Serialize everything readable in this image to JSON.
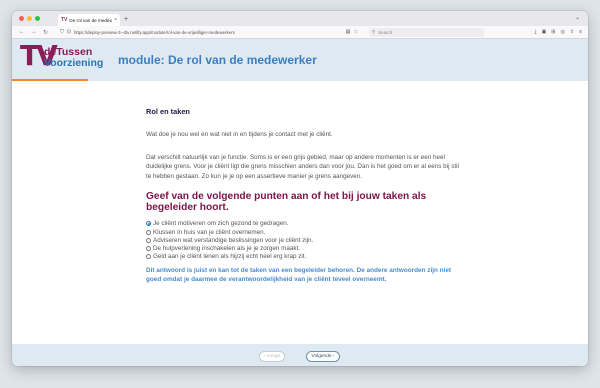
{
  "browser": {
    "tab_title": "De rol van de medewerker",
    "tab_favicon": "TV",
    "url": "https://deploy-preview-3--dtv.netlify.app/module/rol-van-de-vrijwilliger-medewerkers",
    "search_placeholder": "Search"
  },
  "header": {
    "logo_mark": "TV",
    "logo_line1": "deTussen",
    "logo_line2": "Voorziening",
    "module_title": "module: De rol van de medewerker"
  },
  "content": {
    "section_title": "Rol en taken",
    "intro": "Wat doe je nou wel en wat niet in en tijdens je contact met je cliënt.",
    "paragraph": "Dat verschilt natuurlijk van je functie. Soms is er een grijs gebied, maar op andere momenten is er een heel duidelijke grens. Voor je cliënt ligt die grens misschien anders dan voor jou. Dan is het goed om er al eens bij stil te hebben gestaan. Zo kun je je op een assertieve manier je grens aangeven.",
    "question": "Geef van de volgende punten aan of het bij jouw taken als begeleider hoort.",
    "options": [
      {
        "label": "Je cliënt motiveren om zich gezond te gedragen.",
        "selected": true
      },
      {
        "label": "Klussen in huis van je cliënt overnemen.",
        "selected": false
      },
      {
        "label": "Adviseren wat verstandige beslissingen voor je cliënt zijn.",
        "selected": false
      },
      {
        "label": "De hulpverlening inschakelen als je je zorgen maakt.",
        "selected": false
      },
      {
        "label": "Geld aan je cliënt lenen als hij/zij echt heel erg krap zit.",
        "selected": false
      }
    ],
    "feedback": "Dit antwoord is juist en kan tot de taken van een begeleider behoren. De andere antwoorden zijn niet goed omdat je daarmee de verantwoordelijkheid van je cliënt teveel overneemt."
  },
  "footer": {
    "prev_label": "‹ Vorige",
    "next_label": "Volgende ›"
  },
  "colors": {
    "brand_purple": "#8a1c56",
    "brand_blue": "#2a73b5",
    "accent_orange": "#f08a24",
    "header_bg": "#dfe9f1"
  }
}
